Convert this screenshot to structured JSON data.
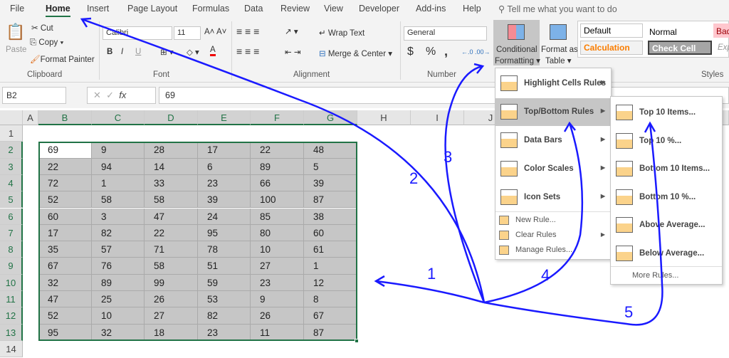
{
  "tabs": [
    "File",
    "Home",
    "Insert",
    "Page Layout",
    "Formulas",
    "Data",
    "Review",
    "View",
    "Developer",
    "Add-ins",
    "Help"
  ],
  "tell_me": "Tell me what you want to do",
  "clipboard": {
    "paste": "Paste",
    "cut": "Cut",
    "copy": "Copy",
    "format_painter": "Format Painter",
    "label": "Clipboard"
  },
  "font": {
    "name": "Calibri",
    "size": "11",
    "bold": "B",
    "italic": "I",
    "underline": "U",
    "label": "Font"
  },
  "alignment": {
    "wrap": "Wrap Text",
    "merge": "Merge & Center",
    "label": "Alignment"
  },
  "number": {
    "format": "General",
    "currency": "$",
    "percent": "%",
    "comma": ",",
    "label": "Number"
  },
  "styles": {
    "cf_line1": "Conditional",
    "cf_line2": "Formatting",
    "fat_line1": "Format as",
    "fat_line2": "Table",
    "default": "Default",
    "normal": "Normal",
    "bad": "Bad",
    "calculation": "Calculation",
    "check_cell": "Check Cell",
    "explanatory": "Exp",
    "label": "Styles"
  },
  "formula_bar": {
    "name_box": "B2",
    "fx": "fx",
    "value": "69"
  },
  "columns": [
    "A",
    "B",
    "C",
    "D",
    "E",
    "F",
    "G",
    "H",
    "I",
    "J"
  ],
  "rows": [
    "1",
    "2",
    "3",
    "4",
    "5",
    "6",
    "7",
    "8",
    "9",
    "10",
    "11",
    "12",
    "13",
    "14"
  ],
  "cells": [
    [
      "69",
      "9",
      "28",
      "17",
      "22",
      "48"
    ],
    [
      "22",
      "94",
      "14",
      "6",
      "89",
      "5"
    ],
    [
      "72",
      "1",
      "33",
      "23",
      "66",
      "39"
    ],
    [
      "52",
      "58",
      "58",
      "39",
      "100",
      "87"
    ],
    [
      "60",
      "3",
      "47",
      "24",
      "85",
      "38"
    ],
    [
      "17",
      "82",
      "22",
      "95",
      "80",
      "60"
    ],
    [
      "35",
      "57",
      "71",
      "78",
      "10",
      "61"
    ],
    [
      "67",
      "76",
      "58",
      "51",
      "27",
      "1"
    ],
    [
      "32",
      "89",
      "99",
      "59",
      "23",
      "12"
    ],
    [
      "47",
      "25",
      "26",
      "53",
      "9",
      "8"
    ],
    [
      "52",
      "10",
      "27",
      "82",
      "26",
      "67"
    ],
    [
      "95",
      "32",
      "18",
      "23",
      "11",
      "87"
    ]
  ],
  "cf_menu": {
    "items": [
      "Highlight Cells Rules",
      "Top/Bottom Rules",
      "Data Bars",
      "Color Scales",
      "Icon Sets"
    ],
    "small": [
      "New Rule...",
      "Clear Rules",
      "Manage Rules..."
    ]
  },
  "submenu": {
    "items": [
      "Top 10 Items...",
      "Top 10 %...",
      "Bottom 10 Items...",
      "Bottom 10 %...",
      "Above Average...",
      "Below Average..."
    ],
    "more": "More Rules..."
  },
  "annotations": [
    "1",
    "2",
    "3",
    "4",
    "5"
  ],
  "colors": {
    "accent": "#217346",
    "annotation": "#1a1aff",
    "selection": "#c6c6c6"
  }
}
